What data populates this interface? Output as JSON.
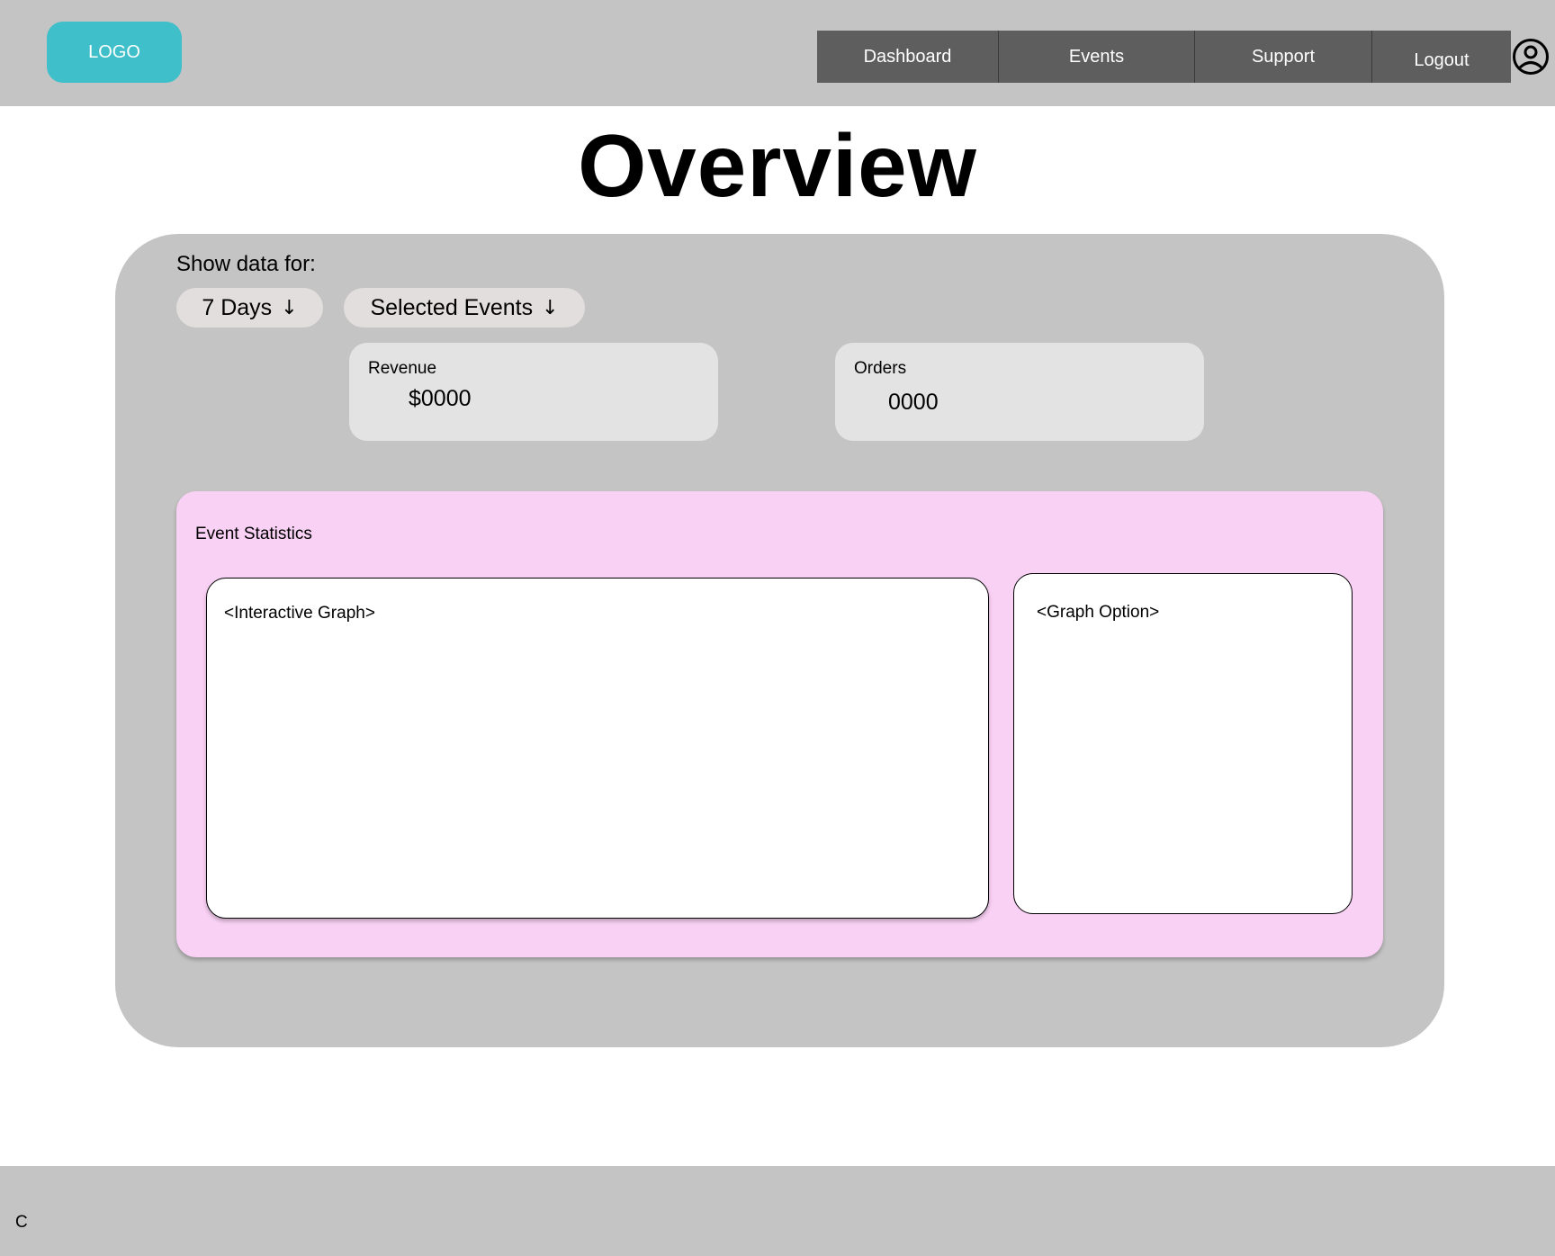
{
  "header": {
    "logo_label": "LOGO",
    "nav": [
      {
        "label": "Dashboard"
      },
      {
        "label": "Events"
      },
      {
        "label": "Support"
      },
      {
        "label": "Logout"
      }
    ],
    "user_icon": "user-circle-icon"
  },
  "page": {
    "title": "Overview"
  },
  "filters": {
    "label": "Show data for:",
    "period_label": "7 Days",
    "events_label": "Selected Events",
    "arrow_glyph": "↓"
  },
  "stats": {
    "revenue": {
      "label": "Revenue",
      "value": "$0000"
    },
    "orders": {
      "label": "Orders",
      "value": "0000"
    }
  },
  "event_statistics": {
    "title": "Event Statistics",
    "graph_placeholder": "<Interactive Graph>",
    "option_placeholder": "<Graph Option>"
  },
  "footer": {
    "text": "C"
  },
  "colors": {
    "header_bg": "#c4c4c4",
    "logo_bg": "#3fbfc9",
    "nav_bg": "#5e5e5e",
    "panel_bg": "#c4c4c4",
    "pill_bg": "#e3dede",
    "card_bg": "#e3e3e3",
    "stats_block_bg": "#f9d1f4"
  }
}
